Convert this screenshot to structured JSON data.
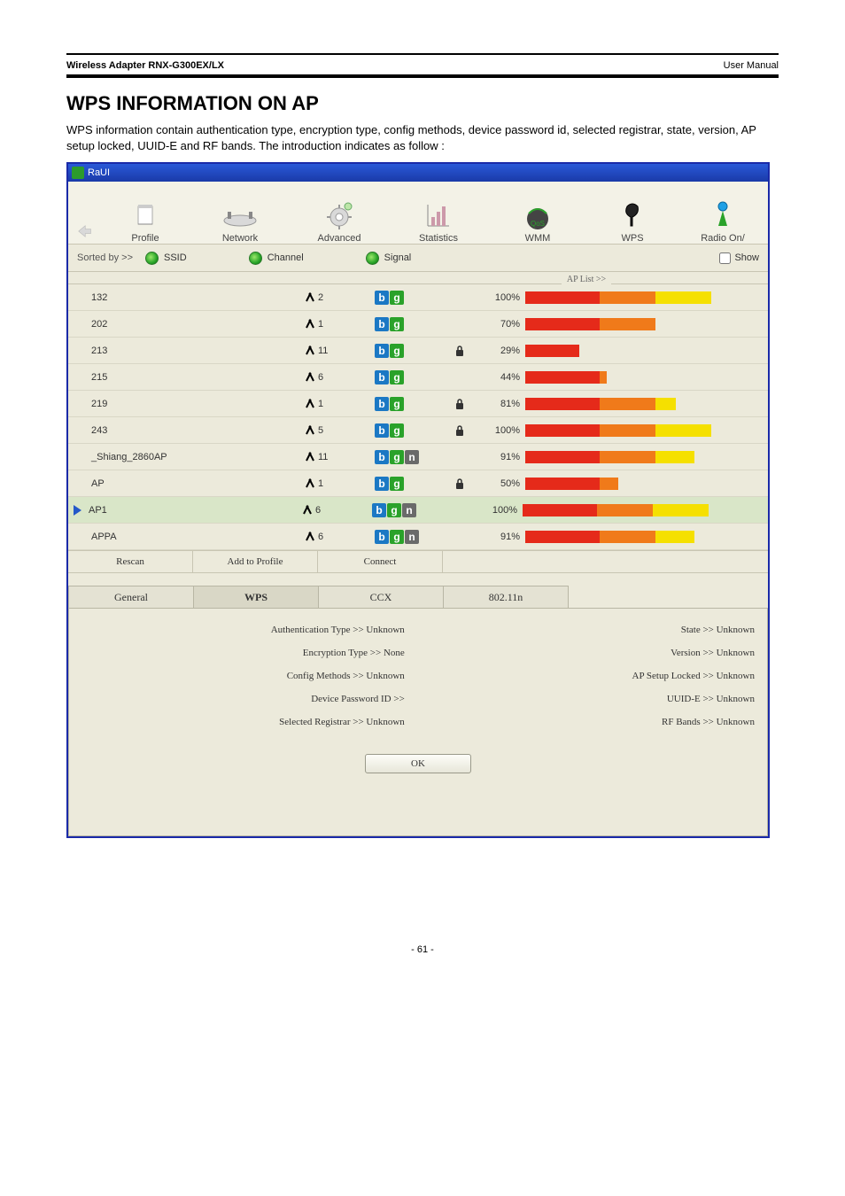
{
  "header": {
    "left": "Wireless Adapter RNX-G300EX/LX",
    "right": "User Manual"
  },
  "section_title": "WPS INFORMATION ON AP",
  "intro": "WPS information contain authentication type, encryption type, config methods, device password id, selected registrar, state, version, AP setup locked, UUID-E and RF bands. The introduction indicates as follow :",
  "app": {
    "title": "RaUI",
    "toolbar": [
      "Profile",
      "Network",
      "Advanced",
      "Statistics",
      "WMM",
      "WPS",
      "Radio On/"
    ],
    "sort_label": "Sorted by >>",
    "sort_opts": [
      "SSID",
      "Channel",
      "Signal"
    ],
    "show_label": "Show",
    "aplist_label": "AP List >>",
    "rows": [
      {
        "ssid": "132",
        "ch": "2",
        "b": true,
        "g": true,
        "n": false,
        "lock": false,
        "sig": "100%",
        "bar": 100,
        "sel": false
      },
      {
        "ssid": "202",
        "ch": "1",
        "b": true,
        "g": true,
        "n": false,
        "lock": false,
        "sig": "70%",
        "bar": 70,
        "sel": false
      },
      {
        "ssid": "213",
        "ch": "11",
        "b": true,
        "g": true,
        "n": false,
        "lock": true,
        "sig": "29%",
        "bar": 29,
        "sel": false
      },
      {
        "ssid": "215",
        "ch": "6",
        "b": true,
        "g": true,
        "n": false,
        "lock": false,
        "sig": "44%",
        "bar": 44,
        "sel": false
      },
      {
        "ssid": "219",
        "ch": "1",
        "b": true,
        "g": true,
        "n": false,
        "lock": true,
        "sig": "81%",
        "bar": 81,
        "sel": false
      },
      {
        "ssid": "243",
        "ch": "5",
        "b": true,
        "g": true,
        "n": false,
        "lock": true,
        "sig": "100%",
        "bar": 100,
        "sel": false
      },
      {
        "ssid": "_Shiang_2860AP",
        "ch": "11",
        "b": true,
        "g": true,
        "n": true,
        "lock": false,
        "sig": "91%",
        "bar": 91,
        "sel": false
      },
      {
        "ssid": "AP",
        "ch": "1",
        "b": true,
        "g": true,
        "n": false,
        "lock": true,
        "sig": "50%",
        "bar": 50,
        "sel": false
      },
      {
        "ssid": "AP1",
        "ch": "6",
        "b": true,
        "g": true,
        "n": true,
        "lock": false,
        "sig": "100%",
        "bar": 100,
        "sel": true
      },
      {
        "ssid": "APPA",
        "ch": "6",
        "b": true,
        "g": true,
        "n": true,
        "lock": false,
        "sig": "91%",
        "bar": 91,
        "sel": false
      }
    ],
    "buttons": [
      "Rescan",
      "Add to Profile",
      "Connect"
    ],
    "tabs": [
      "General",
      "WPS",
      "CCX",
      "802.11n"
    ],
    "wps_left": [
      "Authentication Type >> Unknown",
      "Encryption Type >> None",
      "Config Methods >> Unknown",
      "Device Password ID >>",
      "Selected Registrar >> Unknown"
    ],
    "wps_right": [
      "State >> Unknown",
      "Version >> Unknown",
      "AP Setup Locked >> Unknown",
      "UUID-E >> Unknown",
      "RF Bands >> Unknown"
    ],
    "ok": "OK"
  },
  "page_num": "- 61 -"
}
